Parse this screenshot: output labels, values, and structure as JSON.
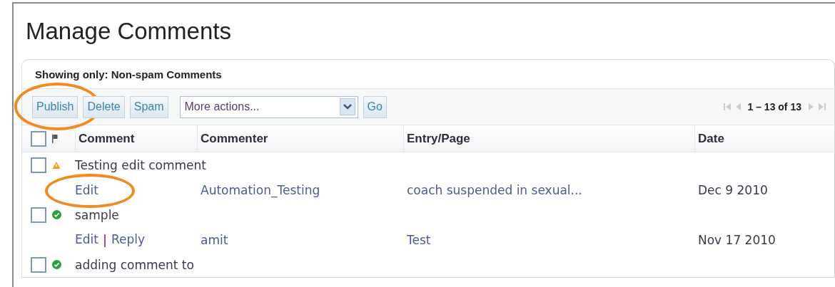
{
  "title": "Manage Comments",
  "filter_label": "Showing only: Non-spam Comments",
  "toolbar": {
    "buttons": [
      {
        "label": "Publish",
        "circled": true
      },
      {
        "label": "Delete",
        "circled": false
      },
      {
        "label": "Spam",
        "circled": false
      }
    ],
    "select": {
      "value": "More actions..."
    },
    "go": "Go",
    "pagination": "1 – 13 of 13"
  },
  "table": {
    "select_all": {
      "checked": false
    },
    "columns": [
      "Comment",
      "Commenter",
      "Entry/Page",
      "Date"
    ],
    "rows": [
      {
        "checked": false,
        "status": {
          "kind": "warning"
        },
        "comment": "Testing edit comment",
        "actions": [
          {
            "label": "Edit",
            "circled": true
          }
        ],
        "commenter": "Automation_Testing",
        "entry": "coach suspended in sexual...",
        "date": "Dec 9 2010"
      },
      {
        "checked": false,
        "status": {
          "kind": "approved"
        },
        "comment": "sample",
        "actions": [
          {
            "label": "Edit",
            "circled": false
          },
          {
            "label": "Reply",
            "circled": false
          }
        ],
        "commenter": "amit",
        "entry": "Test",
        "date": "Nov 17 2010"
      },
      {
        "checked": false,
        "status": {
          "kind": "approved"
        },
        "comment": "adding comment to"
      }
    ]
  }
}
